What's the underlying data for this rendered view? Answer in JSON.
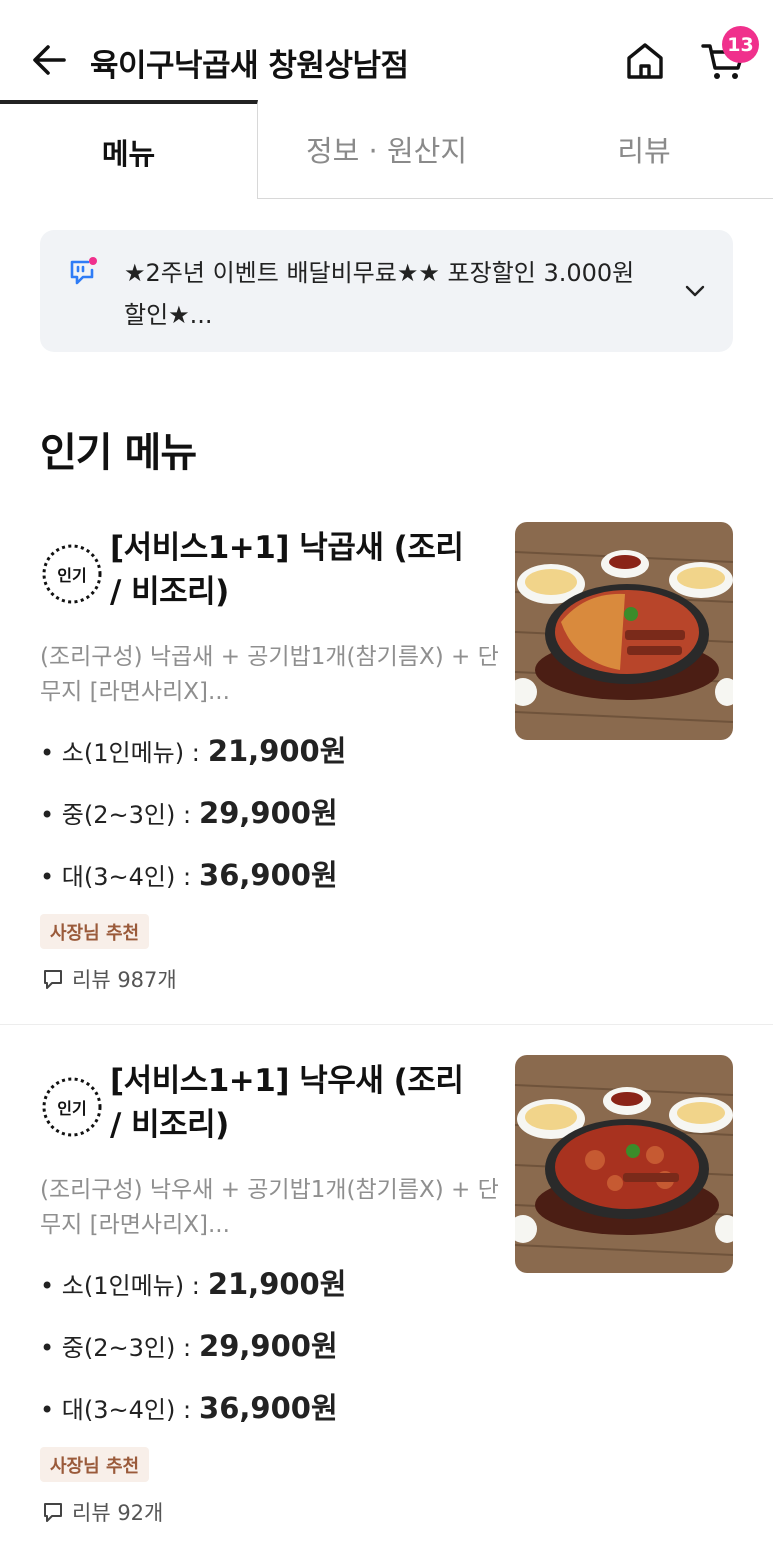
{
  "header": {
    "store_name": "육이구낙곱새 창원상남점",
    "cart_count": "13"
  },
  "tabs": [
    "메뉴",
    "정보 · 원산지",
    "리뷰"
  ],
  "notice": {
    "text": "★2주년 이벤트 배달비무료★★ 포장할인 3.000원 할인★..."
  },
  "section": {
    "title": "인기 메뉴"
  },
  "menu_items": [
    {
      "badge": "인기",
      "name": "[서비스1+1]  낙곱새 (조리 / 비조리)",
      "description": "(조리구성) 낙곱새 + 공기밥1개(참기름X) + 단무지 [라면사리X]...",
      "prices": [
        {
          "label": "• 소(1인메뉴) :",
          "price": "21,900원"
        },
        {
          "label": "• 중(2~3인) :",
          "price": "29,900원"
        },
        {
          "label": "• 대(3~4인) :",
          "price": "36,900원"
        }
      ],
      "tag": "사장님 추천",
      "review": "리뷰 987개"
    },
    {
      "badge": "인기",
      "name": "[서비스1+1]  낙우새  (조리 / 비조리)",
      "description": "(조리구성) 낙우새 + 공기밥1개(참기름X) + 단무지 [라면사리X]...",
      "prices": [
        {
          "label": "• 소(1인메뉴) :",
          "price": "21,900원"
        },
        {
          "label": "• 중(2~3인) :",
          "price": "29,900원"
        },
        {
          "label": "• 대(3~4인) :",
          "price": "36,900원"
        }
      ],
      "tag": "사장님 추천",
      "review": "리뷰 92개"
    }
  ],
  "colors": {
    "accent_badge": "#f0308c",
    "notice_bg": "#f1f3f6",
    "tag_bg": "#f8efe9",
    "tag_text": "#9a5a3a",
    "notice_icon": "#2f7cf6"
  },
  "icons": [
    "back-arrow-icon",
    "home-icon",
    "cart-icon",
    "chat-notice-icon",
    "chevron-down-icon",
    "popular-badge-icon",
    "review-bubble-icon"
  ]
}
